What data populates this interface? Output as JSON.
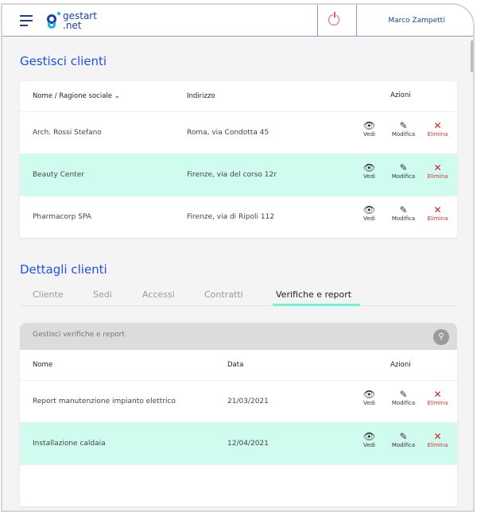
{
  "header": {
    "logo_line1": "gestart",
    "logo_line2": ".net",
    "user": "Marco Zampetti"
  },
  "clients": {
    "title": "Gestisci clienti",
    "columns": [
      "Nome / Ragione sociale",
      "Indirizzo",
      "Azioni"
    ],
    "rows": [
      {
        "name": "Arch. Rossi Stefano",
        "address": "Roma, via Condotta 45"
      },
      {
        "name": "Beauty Center",
        "address": "Firenze, via del corso 12r"
      },
      {
        "name": "Pharmacorp SPA",
        "address": "Firenze, via di Ripoli 112"
      }
    ]
  },
  "actions": {
    "view": "Vedi",
    "edit": "Modifica",
    "delete": "Elimina"
  },
  "details": {
    "title": "Dettagli clienti",
    "tabs": [
      "Cliente",
      "Sedi",
      "Accessi",
      "Contratti",
      "Verifiche e report"
    ],
    "search_placeholder": "Gestisci verifiche e report",
    "columns": [
      "Nome",
      "Data",
      "Azioni"
    ],
    "rows": [
      {
        "name": "Report manutenzione impianto elettrico",
        "date": "21/03/2021"
      },
      {
        "name": "Installazione caldaia",
        "date": "12/04/2021"
      }
    ]
  }
}
